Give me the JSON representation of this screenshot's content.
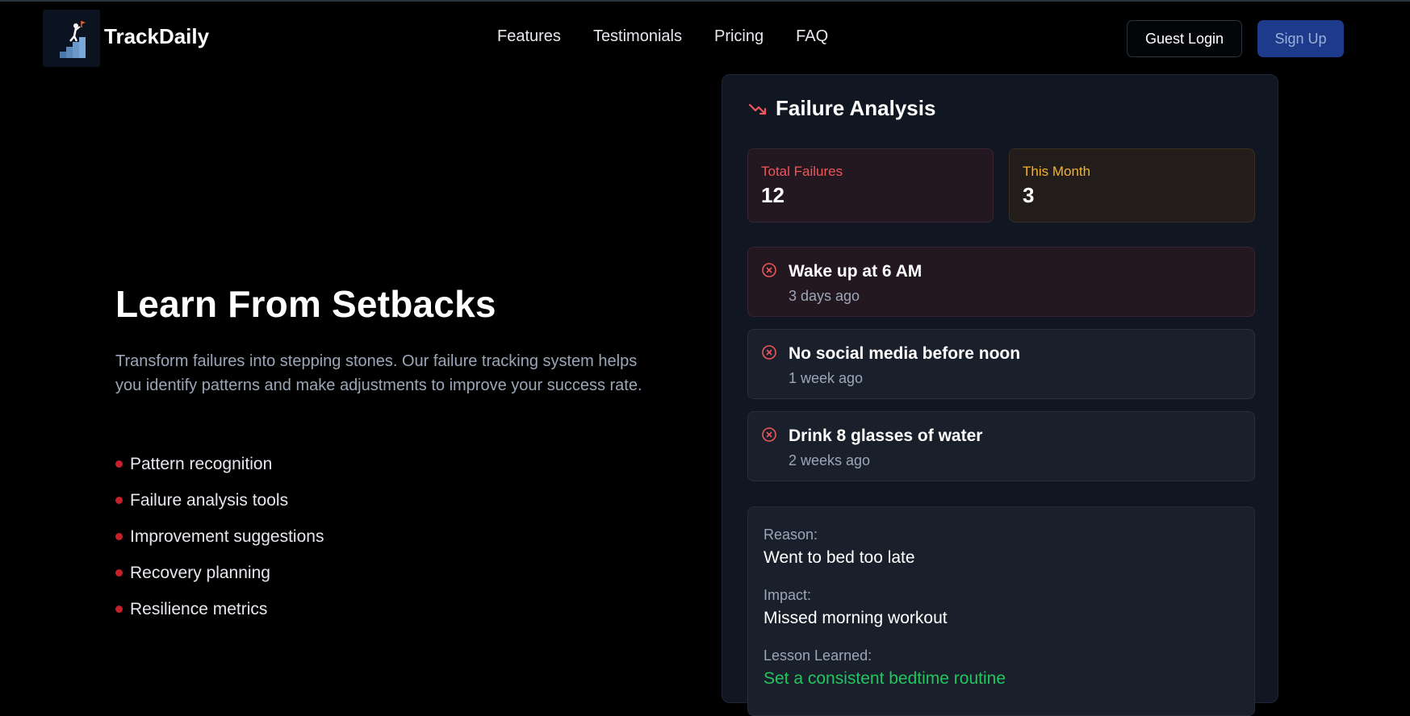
{
  "brand": {
    "name": "TrackDaily",
    "logo_icon": "stairs-climber-icon"
  },
  "nav": {
    "items": [
      "Features",
      "Testimonials",
      "Pricing",
      "FAQ"
    ],
    "guest_login": "Guest Login",
    "sign_up": "Sign Up"
  },
  "hero": {
    "title": "Learn From Setbacks",
    "description": "Transform failures into stepping stones. Our failure tracking system helps you identify patterns and make adjustments to improve your success rate.",
    "features": [
      "Pattern recognition",
      "Failure analysis tools",
      "Improvement suggestions",
      "Recovery planning",
      "Resilience metrics"
    ]
  },
  "panel": {
    "title": "Failure Analysis",
    "title_icon": "trending-down-icon",
    "stats": {
      "total_label": "Total Failures",
      "total_value": "12",
      "month_label": "This Month",
      "month_value": "3"
    },
    "failures": [
      {
        "name": "Wake up at 6 AM",
        "time": "3 days ago"
      },
      {
        "name": "No social media before noon",
        "time": "1 week ago"
      },
      {
        "name": "Drink 8 glasses of water",
        "time": "2 weeks ago"
      }
    ],
    "detail": {
      "reason_label": "Reason:",
      "reason_value": "Went to bed too late",
      "impact_label": "Impact:",
      "impact_value": "Missed morning workout",
      "lesson_label": "Lesson Learned:",
      "lesson_value": "Set a consistent bedtime routine"
    }
  },
  "colors": {
    "accent_blue": "#1e3a8a",
    "failure_red": "#f0555a",
    "month_amber": "#f3b12e",
    "lesson_green": "#22c55e"
  }
}
